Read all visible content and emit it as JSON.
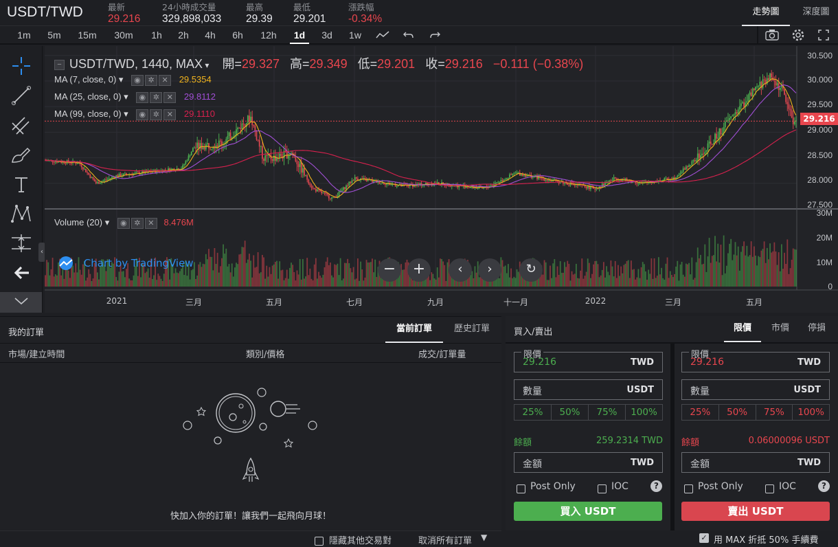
{
  "header": {
    "pair": "USDT/TWD",
    "stats": [
      {
        "label": "最新",
        "value": "29.216",
        "color": "red"
      },
      {
        "label": "24小時成交量",
        "value": "329,898,033",
        "color": "white"
      },
      {
        "label": "最高",
        "value": "29.39",
        "color": "white"
      },
      {
        "label": "最低",
        "value": "29.201",
        "color": "white"
      },
      {
        "label": "漲跌幅",
        "value": "-0.34%",
        "color": "red"
      }
    ],
    "view_tabs": [
      "走勢圖",
      "深度圖"
    ]
  },
  "timeframes": [
    "1m",
    "5m",
    "15m",
    "30m",
    "1h",
    "2h",
    "4h",
    "6h",
    "12h",
    "1d",
    "3d",
    "1w"
  ],
  "active_timeframe": "1d",
  "chart": {
    "symbol": "USDT/TWD, 1440, MAX",
    "ohlc": {
      "open_label": "開=",
      "open": "29.327",
      "high_label": "高=",
      "high": "29.349",
      "low_label": "低=",
      "low": "29.201",
      "close_label": "收=",
      "close": "29.216",
      "change": "−0.111 (−0.38%)"
    },
    "ma": [
      {
        "label": "MA (7, close, 0)",
        "value": "29.5354",
        "color": "#f0b31d"
      },
      {
        "label": "MA (25, close, 0)",
        "value": "29.8112",
        "color": "#a14fd6"
      },
      {
        "label": "MA (99, close, 0)",
        "value": "29.1110",
        "color": "#d8214e"
      }
    ],
    "volume": {
      "label": "Volume (20)",
      "value": "8.476M"
    },
    "watermark": "Chart by TradingView",
    "price_axis": [
      "30.500",
      "30.000",
      "29.500",
      "29.000",
      "28.500",
      "28.000",
      "27.500"
    ],
    "last_price_tag": "29.216",
    "volume_axis": [
      "30M",
      "20M",
      "10M",
      "0"
    ],
    "time_axis": [
      "2021",
      "三月",
      "五月",
      "七月",
      "九月",
      "十一月",
      "2022",
      "三月",
      "五月"
    ]
  },
  "chart_data": {
    "type": "candlestick",
    "title": "USDT/TWD, 1440, MAX",
    "ylim": [
      27.5,
      30.55
    ],
    "x": [
      "2020-11",
      "2021-01",
      "2021-03",
      "2021-05",
      "2021-07",
      "2021-09",
      "2021-11",
      "2022-01",
      "2022-03",
      "2022-05"
    ],
    "close_approx": [
      28.45,
      28.15,
      28.55,
      28.9,
      27.85,
      27.95,
      27.95,
      27.85,
      28.4,
      29.216
    ],
    "volume_max": "30M"
  },
  "orders": {
    "title": "我的訂單",
    "tabs": [
      "當前訂單",
      "歷史訂單"
    ],
    "columns": [
      "市場/建立時間",
      "類別/價格",
      "成交/訂單量"
    ],
    "empty_text": "快加入你的訂單！讓我們一起飛向月球！",
    "footer_hide": "隱藏其他交易對",
    "footer_cancel": "取消所有訂單"
  },
  "trade": {
    "title": "買入/賣出",
    "order_types": [
      "限價",
      "市價",
      "停損"
    ],
    "buy": {
      "limit_label": "限價",
      "limit_value": "29.216",
      "limit_unit": "TWD",
      "qty_label": "數量",
      "qty_unit": "USDT",
      "pcts": [
        "25%",
        "50%",
        "75%",
        "100%"
      ],
      "balance_label": "餘額",
      "balance": "259.2314 TWD",
      "amount_label": "金額",
      "amount_unit": "TWD",
      "post_only": "Post Only",
      "ioc": "IOC",
      "button": "買入 USDT"
    },
    "sell": {
      "limit_label": "限價",
      "limit_value": "29.216",
      "limit_unit": "TWD",
      "qty_label": "數量",
      "qty_unit": "USDT",
      "pcts": [
        "25%",
        "50%",
        "75%",
        "100%"
      ],
      "balance_label": "餘額",
      "balance": "0.06000096 USDT",
      "amount_label": "金額",
      "amount_unit": "TWD",
      "post_only": "Post Only",
      "ioc": "IOC",
      "button": "賣出 USDT"
    },
    "footer": "用 MAX 折抵 50% 手續費"
  }
}
